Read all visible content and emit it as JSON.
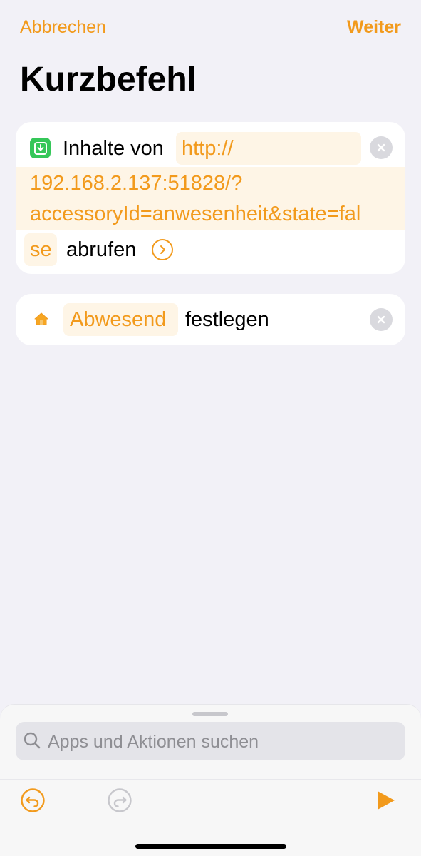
{
  "nav": {
    "cancel_label": "Abbrechen",
    "next_label": "Weiter"
  },
  "page_title": "Kurzbefehl",
  "actions": [
    {
      "icon": "download-icon",
      "prefix": "Inhalte von",
      "url_lines": [
        "http://",
        "192.168.2.137:51828/?",
        "accessoryId=anwesenheit&state=fal",
        "se"
      ],
      "suffix": "abrufen"
    },
    {
      "icon": "home-icon",
      "token": "Abwesend",
      "suffix": "festlegen"
    }
  ],
  "search": {
    "placeholder": "Apps und Aktionen suchen"
  },
  "colors": {
    "accent": "#f29a1c",
    "token_bg": "#fef5e6",
    "background": "#f2f1f7",
    "green": "#35c759"
  }
}
